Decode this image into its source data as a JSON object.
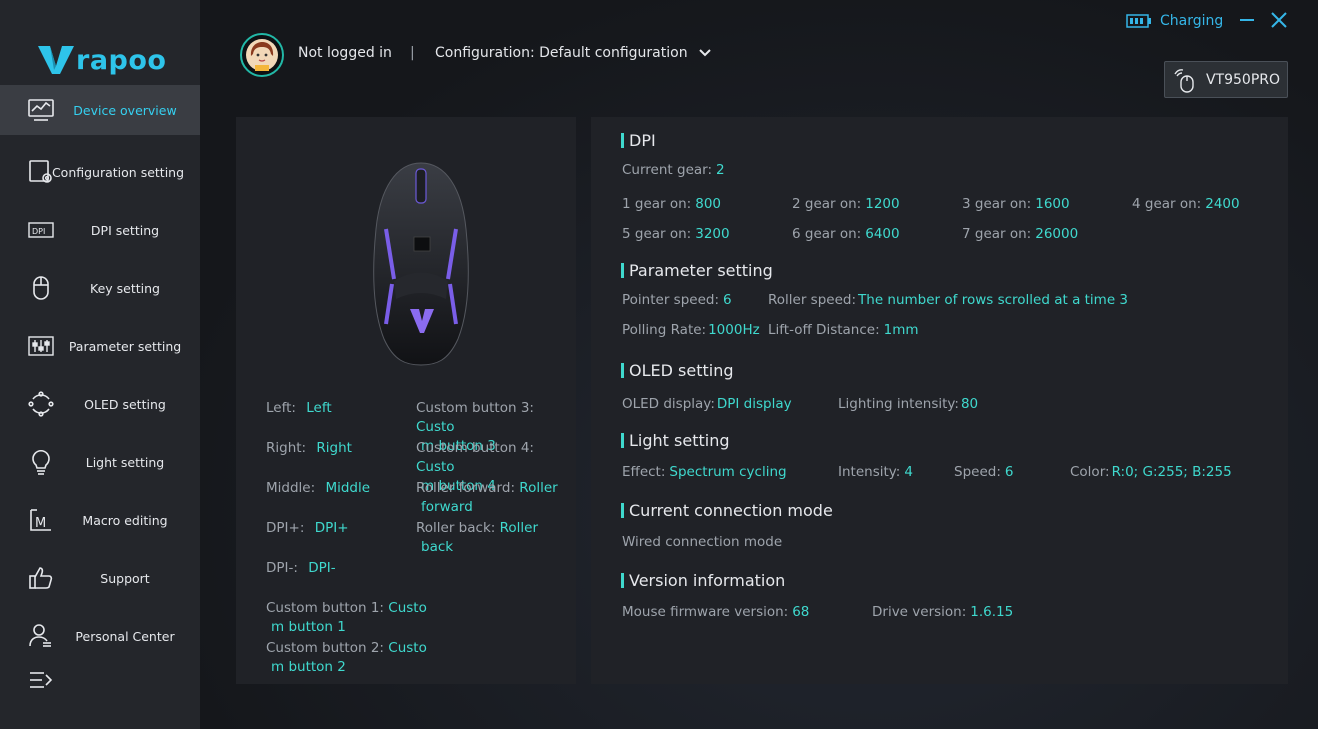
{
  "brand": {
    "name": "rapoo",
    "color": "#2ec4ea"
  },
  "sidebar": {
    "items": [
      {
        "label": "Device overview",
        "icon": "monitor-chart-icon",
        "active": true
      },
      {
        "label": "Configuration setting",
        "icon": "config-gear-icon"
      },
      {
        "label": "DPI setting",
        "icon": "dpi-icon"
      },
      {
        "label": "Key setting",
        "icon": "mouse-icon"
      },
      {
        "label": "Parameter setting",
        "icon": "sliders-icon"
      },
      {
        "label": "OLED setting",
        "icon": "refresh-circle-icon"
      },
      {
        "label": "Light setting",
        "icon": "lightbulb-icon"
      },
      {
        "label": "Macro editing",
        "icon": "macro-icon"
      },
      {
        "label": "Support",
        "icon": "thumbs-up-icon"
      },
      {
        "label": "Personal Center",
        "icon": "user-icon"
      }
    ]
  },
  "header": {
    "login_status": "Not logged in",
    "separator": "|",
    "configuration": "Configuration: Default configuration",
    "battery_status": "Charging",
    "device_name": "VT950PRO"
  },
  "keys": {
    "left": {
      "label": "Left:",
      "value": "Left"
    },
    "right": {
      "label": "Right:",
      "value": "Right"
    },
    "middle": {
      "label": "Middle:",
      "value": "Middle"
    },
    "dpi_plus": {
      "label": "DPI+:",
      "value": "DPI+"
    },
    "dpi_minus": {
      "label": "DPI-:",
      "value": "DPI-"
    },
    "custom1": {
      "label": "Custom button 1:",
      "value_a": "Custo",
      "value_b": "m button 1"
    },
    "custom2": {
      "label": "Custom button 2:",
      "value_a": "Custo",
      "value_b": "m button 2"
    },
    "custom3": {
      "label": "Custom button 3:",
      "value_a": "Custo",
      "value_b": "m button 3"
    },
    "custom4": {
      "label": "Custom button 4:",
      "value_a": "Custo",
      "value_b": "m button 4"
    },
    "roller_forward": {
      "label": "Roller forward:",
      "value_a": "Roller",
      "value_b": "forward"
    },
    "roller_back": {
      "label": "Roller back:",
      "value_a": "Roller",
      "value_b": "back"
    }
  },
  "dpi": {
    "title": "DPI",
    "current_label": "Current gear:",
    "current_value": "2",
    "gears": [
      {
        "label": "1 gear on:",
        "value": "800"
      },
      {
        "label": "2 gear on:",
        "value": "1200"
      },
      {
        "label": "3 gear on:",
        "value": "1600"
      },
      {
        "label": "4 gear on:",
        "value": "2400"
      },
      {
        "label": "5 gear on:",
        "value": "3200"
      },
      {
        "label": "6 gear on:",
        "value": "6400"
      },
      {
        "label": "7 gear on:",
        "value": "26000"
      }
    ]
  },
  "parameter": {
    "title": "Parameter setting",
    "pointer_label": "Pointer speed:",
    "pointer_value": "6",
    "roller_label": "Roller speed:",
    "roller_value": "The number of rows scrolled at a time 3",
    "polling_label": "Polling Rate:",
    "polling_value": "1000Hz",
    "liftoff_label": "Lift-off Distance:",
    "liftoff_value": "1mm"
  },
  "oled": {
    "title": "OLED setting",
    "display_label": "OLED display:",
    "display_value": "DPI display",
    "intensity_label": "Lighting intensity:",
    "intensity_value": "80"
  },
  "light": {
    "title": "Light setting",
    "effect_label": "Effect:",
    "effect_value": "Spectrum cycling",
    "intensity_label": "Intensity:",
    "intensity_value": "4",
    "speed_label": "Speed:",
    "speed_value": "6",
    "color_label": "Color:",
    "color_value": "R:0; G:255; B:255"
  },
  "connection": {
    "title": "Current connection mode",
    "mode": "Wired connection mode"
  },
  "version": {
    "title": "Version information",
    "firmware_label": "Mouse firmware version:",
    "firmware_value": "68",
    "drive_label": "Drive version:",
    "drive_value": "1.6.15"
  },
  "colors": {
    "accent": "#3fd9ce",
    "nav_active": "#35d0f0",
    "charging": "#35b6e8"
  }
}
